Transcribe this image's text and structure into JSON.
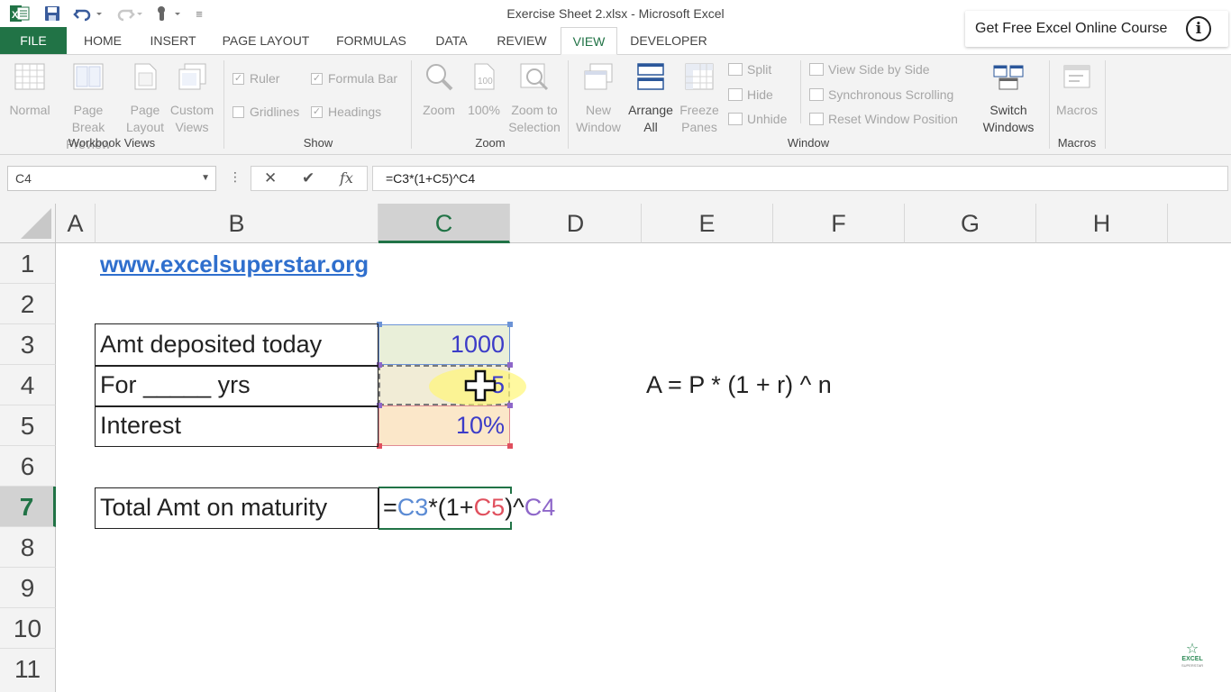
{
  "window": {
    "title": "Exercise Sheet 2.xlsx - Microsoft Excel"
  },
  "promo": {
    "label": "Get Free Excel Online Course"
  },
  "tabs": [
    "FILE",
    "HOME",
    "INSERT",
    "PAGE LAYOUT",
    "FORMULAS",
    "DATA",
    "REVIEW",
    "VIEW",
    "DEVELOPER"
  ],
  "active_tab": "VIEW",
  "ribbon": {
    "workbook_views": {
      "label": "Workbook Views",
      "buttons": [
        {
          "line1": "Normal",
          "line2": ""
        },
        {
          "line1": "Page Break",
          "line2": "Preview"
        },
        {
          "line1": "Page",
          "line2": "Layout"
        },
        {
          "line1": "Custom",
          "line2": "Views"
        }
      ]
    },
    "show": {
      "label": "Show",
      "ruler": "Ruler",
      "formula_bar": "Formula Bar",
      "gridlines": "Gridlines",
      "headings": "Headings"
    },
    "zoom": {
      "label": "Zoom",
      "buttons": [
        {
          "line1": "Zoom",
          "line2": ""
        },
        {
          "line1": "100%",
          "line2": ""
        },
        {
          "line1": "Zoom to",
          "line2": "Selection"
        }
      ]
    },
    "window": {
      "label": "Window",
      "new_window": {
        "line1": "New",
        "line2": "Window"
      },
      "arrange_all": {
        "line1": "Arrange",
        "line2": "All"
      },
      "freeze_panes": {
        "line1": "Freeze",
        "line2": "Panes"
      },
      "split": "Split",
      "hide": "Hide",
      "unhide": "Unhide",
      "view_side_by_side": "View Side by Side",
      "synchronous_scrolling": "Synchronous Scrolling",
      "reset_window_position": "Reset Window Position",
      "switch_windows": {
        "line1": "Switch",
        "line2": "Windows"
      }
    },
    "macros": {
      "label": "Macros",
      "button": "Macros"
    }
  },
  "formula_bar": {
    "name_box": "C4",
    "formula": "=C3*(1+C5)^C4"
  },
  "columns": [
    "A",
    "B",
    "C",
    "D",
    "E",
    "F",
    "G",
    "H"
  ],
  "selected_column": "C",
  "rows": [
    "1",
    "2",
    "3",
    "4",
    "5",
    "6",
    "7",
    "8",
    "9",
    "10",
    "11"
  ],
  "selected_row": "7",
  "cells": {
    "b1": "www.excelsuperstar.org",
    "b3": "Amt deposited today",
    "c3": "1000",
    "b4": "For _____ yrs",
    "c4": "5",
    "b5": "Interest",
    "c5": "10%",
    "b7": "Total Amt on maturity",
    "c7": {
      "p1": "=",
      "p2": "C3",
      "p3": "*(1+",
      "p4": "C5",
      "p5": ")^",
      "p6": "C4"
    },
    "e4": "A = P * (1 + r) ^ n"
  },
  "logo": {
    "line1": "EXCEL",
    "line2": "SUPERSTAR"
  },
  "colors": {
    "excel_green": "#217346",
    "ref_blue": "#5b8bd4",
    "ref_red": "#e0505e",
    "ref_purple": "#8e67c9",
    "link_blue": "#2f6fcd"
  }
}
